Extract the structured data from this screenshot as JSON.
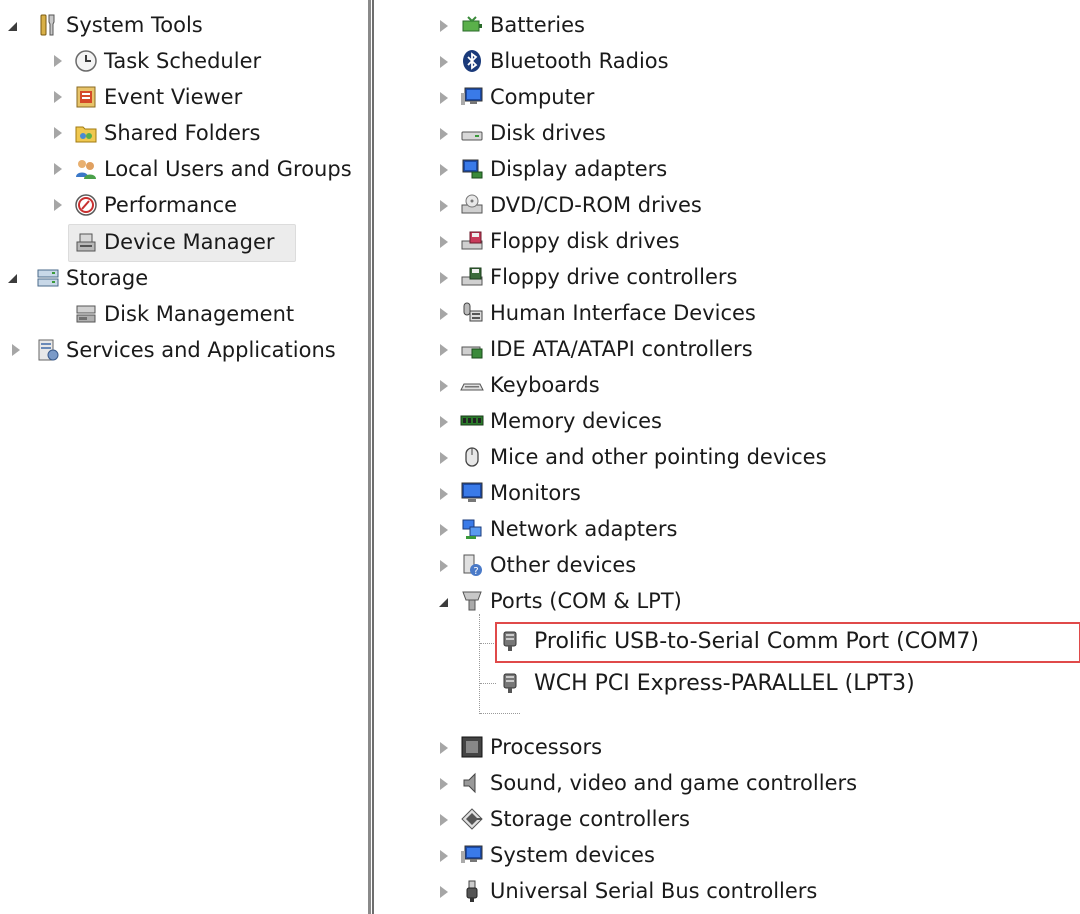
{
  "left_tree": {
    "system_tools": "System Tools",
    "task_scheduler": "Task Scheduler",
    "event_viewer": "Event Viewer",
    "shared_folders": "Shared Folders",
    "local_users_groups": "Local Users and Groups",
    "performance": "Performance",
    "device_manager": "Device Manager",
    "storage": "Storage",
    "disk_management": "Disk Management",
    "services_applications": "Services and Applications"
  },
  "devices": {
    "batteries": "Batteries",
    "bluetooth": "Bluetooth Radios",
    "computer": "Computer",
    "disk_drives": "Disk drives",
    "display_adapters": "Display adapters",
    "dvd": "DVD/CD-ROM drives",
    "floppy_disk": "Floppy disk drives",
    "floppy_ctrl": "Floppy drive controllers",
    "hid": "Human Interface Devices",
    "ide": "IDE ATA/ATAPI controllers",
    "keyboards": "Keyboards",
    "memory": "Memory devices",
    "mice": "Mice and other pointing devices",
    "monitors": "Monitors",
    "network": "Network adapters",
    "other": "Other devices",
    "ports": "Ports (COM & LPT)",
    "port_com7": "Prolific USB-to-Serial Comm Port (COM7)",
    "port_lpt3": "WCH PCI Express-PARALLEL (LPT3)",
    "processors": "Processors",
    "sound": "Sound, video and game controllers",
    "storage_ctrl": "Storage controllers",
    "system_devices": "System devices",
    "usb": "Universal Serial Bus controllers"
  },
  "colors": {
    "highlight": "#e04a4a",
    "selection": "#ececec"
  }
}
